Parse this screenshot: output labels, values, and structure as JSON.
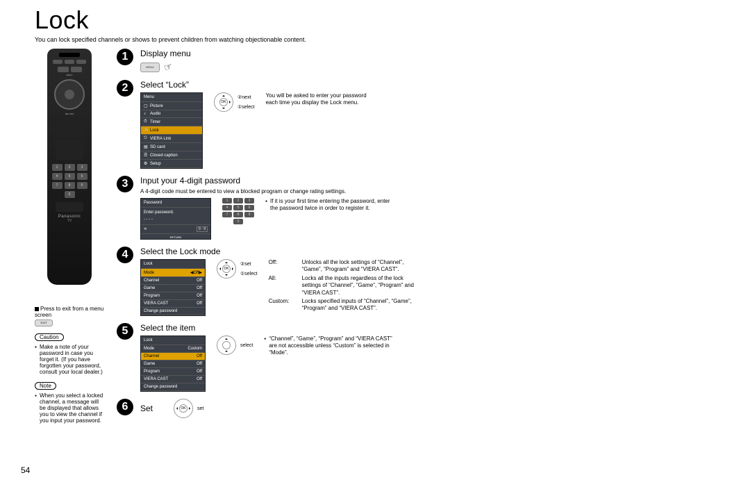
{
  "page_number": "54",
  "title": "Lock",
  "subtitle": "You can lock specified channels or shows to prevent children from watching objectionable content.",
  "remote": {
    "brand": "Panasonic",
    "brand_sub": "TV",
    "labels": {
      "menu": "MENU",
      "exit": "EXIT",
      "ok": "OK",
      "return": "RETURN"
    },
    "keypad": [
      {
        "n": "1",
        "s": "@."
      },
      {
        "n": "2",
        "s": "ABC"
      },
      {
        "n": "3",
        "s": "DEF"
      },
      {
        "n": "4",
        "s": "GHI"
      },
      {
        "n": "5",
        "s": "JKL"
      },
      {
        "n": "6",
        "s": "MNO"
      },
      {
        "n": "7",
        "s": "PQRS"
      },
      {
        "n": "8",
        "s": "TUV"
      },
      {
        "n": "9",
        "s": "WXYZ"
      },
      {
        "n": "0",
        "s": ""
      }
    ]
  },
  "left_notes": {
    "exit_instruction": "Press to exit from a menu screen",
    "exit_button_label": "EXIT",
    "caution_heading": "Caution",
    "caution_text": "Make a note of your password in case you forget it. (If you have forgotten your password, consult your local dealer.)",
    "note_heading": "Note",
    "note_text": "When you select a locked channel, a message will be displayed that allows you to view the channel if you input your password."
  },
  "steps": {
    "s1": {
      "title": "Display menu",
      "button_label": "MENU"
    },
    "s2": {
      "title": "Select “Lock”",
      "osd_title": "Menu",
      "osd_items": [
        "Picture",
        "Audio",
        "Timer",
        "Lock",
        "VIERA Link",
        "SD card",
        "Closed caption",
        "Setup"
      ],
      "osd_selected_index": 3,
      "dpad_next": "next",
      "dpad_select": "select",
      "ok_label": "OK",
      "note": "You will be asked to enter your password each time you display the Lock menu."
    },
    "s3": {
      "title": "Input your 4-digit password",
      "intro": "A 4-digit code must be entered to view a blocked program or change rating settings.",
      "osd_title": "Password",
      "osd_prompt": "Enter password.",
      "osd_value": "- - - -",
      "keypad_hint": [
        "1",
        "2",
        "3",
        "4",
        "5",
        "6",
        "7",
        "8",
        "9",
        "0"
      ],
      "return_label": "RETURN",
      "note": "If it is your first time entering the password, enter the password twice in order to register it."
    },
    "s4": {
      "title": "Select the Lock mode",
      "osd_title": "Lock",
      "osd_rows": [
        {
          "k": "Mode",
          "v": "Off",
          "sel": true
        },
        {
          "k": "Channel",
          "v": "Off"
        },
        {
          "k": "Game",
          "v": "Off"
        },
        {
          "k": "Program",
          "v": "Off"
        },
        {
          "k": "VIERA CAST",
          "v": "Off"
        },
        {
          "k": "Change password",
          "v": ""
        }
      ],
      "dpad_set": "set",
      "dpad_select": "select",
      "ok_label": "OK",
      "desc": [
        {
          "k": "Off:",
          "v": "Unlocks all the lock settings of “Channel”, “Game”, “Program” and “VIERA CAST”."
        },
        {
          "k": "All:",
          "v": "Locks all the inputs regardless of the lock settings of “Channel”, “Game”, “Program” and “VIERA CAST”."
        },
        {
          "k": "Custom:",
          "v": "Locks specified inputs of “Channel”, “Game”, “Program” and “VIERA CAST”."
        }
      ]
    },
    "s5": {
      "title": "Select the item",
      "osd_title": "Lock",
      "osd_rows": [
        {
          "k": "Mode",
          "v": "Custom"
        },
        {
          "k": "Channel",
          "v": "Off",
          "sel": true
        },
        {
          "k": "Game",
          "v": "Off"
        },
        {
          "k": "Program",
          "v": "Off"
        },
        {
          "k": "VIERA CAST",
          "v": "Off"
        },
        {
          "k": "Change password",
          "v": ""
        }
      ],
      "dpad_select": "select",
      "note": "“Channel”, “Game”, “Program” and “VIERA CAST” are not accessible unless “Custom” is selected in “Mode”."
    },
    "s6": {
      "title": "Set",
      "dpad_set": "set",
      "ok_label": "OK"
    }
  }
}
